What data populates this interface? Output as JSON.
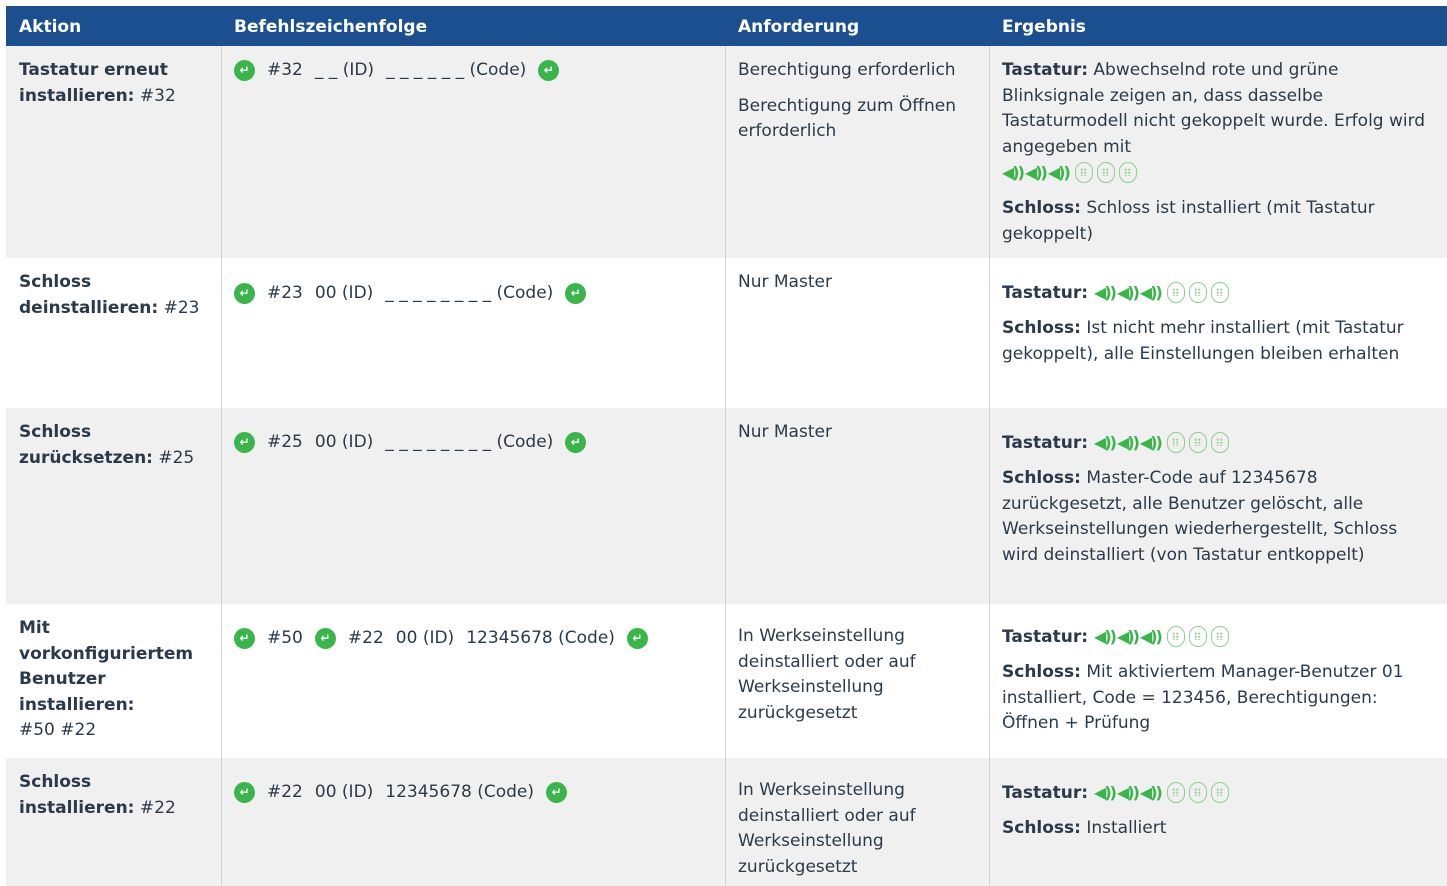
{
  "header": {
    "col_action": "Aktion",
    "col_sequence": "Befehlszeichenfolge",
    "col_requirement": "Anforderung",
    "col_result": "Ergebnis"
  },
  "icons": {
    "enter": "enter-key-icon",
    "speaker": "speaker-beep-icon",
    "keypad": "keypad-flash-icon",
    "enter_glyph": "↵",
    "speaker_glyph": "◀))"
  },
  "colors": {
    "header_bg": "#1c4f8f",
    "accent_green": "#3ab54a",
    "row_gray": "#f0f0f0"
  },
  "rows": [
    {
      "action_bold": "Tastatur erneut installieren:",
      "action_code": " #32",
      "seq": [
        "#32",
        "_ _ (ID)",
        "_ _ _ _ _ _ (Code)"
      ],
      "req": [
        "Berechtigung erforderlich",
        "Berechtigung zum Öffnen erforderlich"
      ],
      "res_label": "Tastatur:",
      "res_text": " Abwechselnd rote und grüne Blinksignale zeigen an, dass dasselbe Tastaturmodell nicht gekoppelt wurde. Erfolg wird angegeben mit",
      "lock_label": "Schloss:",
      "lock_text": " Schloss ist installiert (mit Tastatur gekoppelt)"
    },
    {
      "action_bold": "Schloss deinstallieren:",
      "action_code": " #23",
      "seq": [
        "#23",
        "00 (ID)",
        "_ _ _ _ _ _ _ _ (Code)"
      ],
      "req": [
        "Nur Master"
      ],
      "res_label": "Tastatur:",
      "lock_label": "Schloss:",
      "lock_text": " Ist nicht mehr installiert (mit Tastatur gekoppelt), alle Einstellungen bleiben erhalten"
    },
    {
      "action_bold": "Schloss zurücksetzen:",
      "action_code": " #25",
      "seq": [
        "#25",
        "00 (ID)",
        "_ _ _ _ _ _ _ _ (Code)"
      ],
      "req": [
        "Nur Master"
      ],
      "res_label": "Tastatur:",
      "lock_label": "Schloss:",
      "lock_text": " Master-Code auf 12345678 zurückgesetzt, alle Benutzer gelöscht, alle Werkseinstellungen wiederhergestellt, Schloss wird deinstalliert (von Tastatur entkoppelt)"
    },
    {
      "action_bold": "Mit vorkonfiguriertem Benutzer installieren:",
      "action_code": "#50 #22",
      "seq": [
        "#50",
        "#22",
        "00 (ID)",
        "12345678 (Code)"
      ],
      "req": [
        "In Werkseinstellung deinstalliert oder auf Werkseinstellung zurückgesetzt"
      ],
      "res_label": "Tastatur:",
      "lock_label": "Schloss:",
      "lock_text": " Mit aktiviertem Manager-Benutzer 01 installiert, Code = 123456, Berechtigungen: Öffnen + Prüfung"
    },
    {
      "action_bold": "Schloss installieren:",
      "action_code": " #22",
      "seq": [
        "#22",
        "00 (ID)",
        "12345678 (Code)"
      ],
      "req": [
        "In Werkseinstellung deinstalliert oder auf Werkseinstellung zurückgesetzt"
      ],
      "res_label": "Tastatur:",
      "lock_label": "Schloss:",
      "lock_text": " Installiert"
    }
  ]
}
